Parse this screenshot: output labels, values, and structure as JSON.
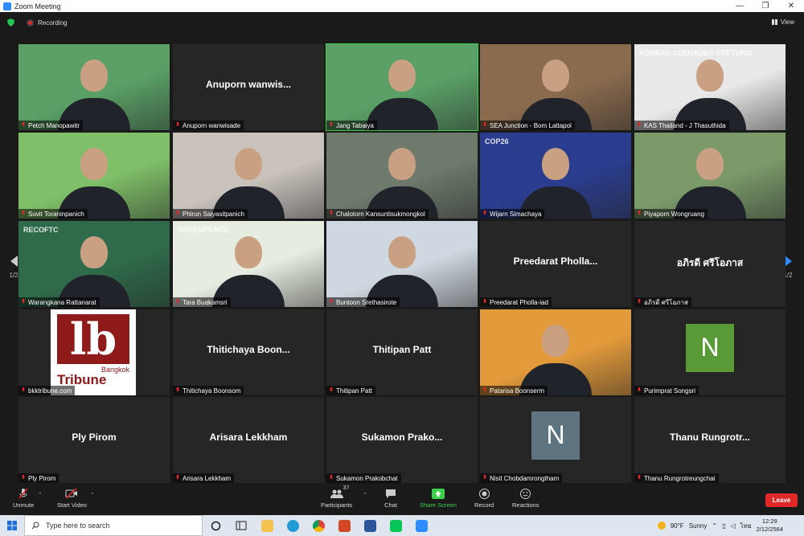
{
  "window": {
    "title": "Zoom Meeting",
    "min": "—",
    "max": "❐",
    "close": "✕"
  },
  "topbar": {
    "recording_label": "Recording",
    "view_label": "View"
  },
  "pager": {
    "left_label": "1/2",
    "right_label": "1/2"
  },
  "tiles": [
    {
      "name": "Petch Manopawitr",
      "big": "",
      "kind": "video",
      "bg": "#5aa066"
    },
    {
      "name": "Anuporn wanwisade",
      "big": "Anuporn  wanwis...",
      "kind": "name"
    },
    {
      "name": "Jang Tabaiya",
      "big": "",
      "kind": "video",
      "bg": "#5aa066",
      "active": true
    },
    {
      "name": "SEA Junction - Bom Lattapol",
      "big": "",
      "kind": "video",
      "bg": "#8a6b4e"
    },
    {
      "name": "KAS Thailand - J Thasuthida",
      "big": "",
      "kind": "video",
      "bg": "#e8e8e8",
      "logo": "KONRAD ADENAUER STIFTUNG"
    },
    {
      "name": "Suvit Toraninpanich",
      "big": "",
      "kind": "video",
      "bg": "#7fbf68"
    },
    {
      "name": "Phirun Saiyasitpanich",
      "big": "",
      "kind": "video",
      "bg": "#c9c3bc"
    },
    {
      "name": "Chalotorn Kansuntisukmongkol",
      "big": "",
      "kind": "video",
      "bg": "#6d7a6c"
    },
    {
      "name": "Wijarn Simachaya",
      "big": "",
      "kind": "video",
      "bg": "#2a3d8e",
      "logo": "COP26"
    },
    {
      "name": "Piyaporn Wongruang",
      "big": "",
      "kind": "video",
      "bg": "#7b9a6a"
    },
    {
      "name": "Warangkana Rattanarat",
      "big": "",
      "kind": "video",
      "bg": "#2f6b4a",
      "logo": "RECOFTC"
    },
    {
      "name": "Tara Buakamsri",
      "big": "",
      "kind": "video",
      "bg": "#e6ede0",
      "logo": "GREENPEACE"
    },
    {
      "name": "Buntoon Srethasirote",
      "big": "",
      "kind": "video",
      "bg": "#cfd8e0"
    },
    {
      "name": "Preedarat Pholla-iad",
      "big": "Preedarat  Pholla...",
      "kind": "name"
    },
    {
      "name": "อภิรดี ศรีโอภาส",
      "big": "อภิรดี ศรีโอภาส",
      "kind": "name"
    },
    {
      "name": "bkktribune.com",
      "big": "",
      "kind": "logo",
      "logo_text": "Bangkok",
      "logo_text2": "Tribune"
    },
    {
      "name": "Thitichaya Boonsom",
      "big": "Thitichaya  Boon...",
      "kind": "name"
    },
    {
      "name": "Thitipan Patt",
      "big": "Thitipan Patt",
      "kind": "name"
    },
    {
      "name": "Patarisa Boonserm",
      "big": "",
      "kind": "video",
      "bg": "#e39a3b"
    },
    {
      "name": "Purimprat Songsri",
      "big": "",
      "kind": "avatar",
      "letter": "N",
      "avatar_color": "#5a9a36"
    },
    {
      "name": "Ply Pirom",
      "big": "Ply Pirom",
      "kind": "name"
    },
    {
      "name": "Arisara Lekkham",
      "big": "Arisara Lekkham",
      "kind": "name"
    },
    {
      "name": "Sukamon Prakobchat",
      "big": "Sukamon  Prako...",
      "kind": "name"
    },
    {
      "name": "Nisit Chobdamrongtham",
      "big": "",
      "kind": "avatar",
      "letter": "N",
      "avatar_color": "#5e7480"
    },
    {
      "name": "Thanu Rungrotreungchai",
      "big": "Thanu  Rungrotr...",
      "kind": "name"
    }
  ],
  "toolbar": {
    "unmute": "Unmute",
    "start_video": "Start Video",
    "participants": "Participants",
    "participants_count": "37",
    "chat": "Chat",
    "share": "Share Screen",
    "record": "Record",
    "reactions": "Reactions",
    "leave": "Leave"
  },
  "taskbar": {
    "search_placeholder": "Type here to search",
    "weather_temp": "90°F",
    "weather_desc": "Sunny",
    "lang": "ไทย",
    "time": "12:29",
    "date": "2/12/2564"
  },
  "colors": {
    "accent_green": "#3ad04a",
    "leave_red": "#e02828",
    "zoom_blue": "#2d8cff"
  }
}
